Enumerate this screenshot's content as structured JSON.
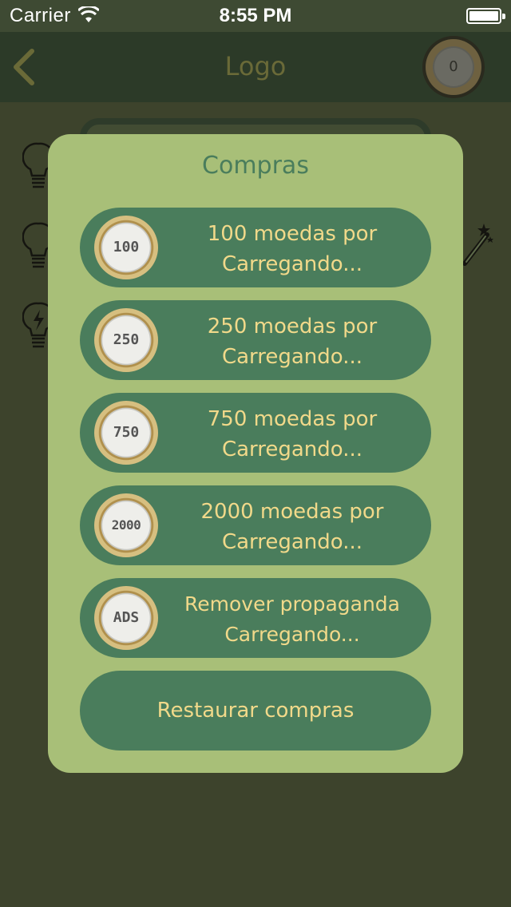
{
  "status_bar": {
    "carrier": "Carrier",
    "time": "8:55 PM"
  },
  "nav": {
    "title": "Logo",
    "coin_count": "0",
    "back_icon": "chevron-left-icon"
  },
  "modal": {
    "title": "Compras",
    "items": [
      {
        "coin_label": "100",
        "line1": "100 moedas por",
        "line2": "Carregando..."
      },
      {
        "coin_label": "250",
        "line1": "250 moedas por",
        "line2": "Carregando..."
      },
      {
        "coin_label": "750",
        "line1": "750 moedas por",
        "line2": "Carregando..."
      },
      {
        "coin_label": "2000",
        "line1": "2000 moedas por",
        "line2": "Carregando..."
      },
      {
        "coin_label": "ADS",
        "line1": "Remover propaganda",
        "line2": "Carregando..."
      }
    ],
    "restore_label": "Restaurar compras"
  },
  "colors": {
    "modal_bg": "#a8bf78",
    "button_bg": "#4a7d5c",
    "button_text": "#f1d98a",
    "backdrop": "#3d432c"
  }
}
